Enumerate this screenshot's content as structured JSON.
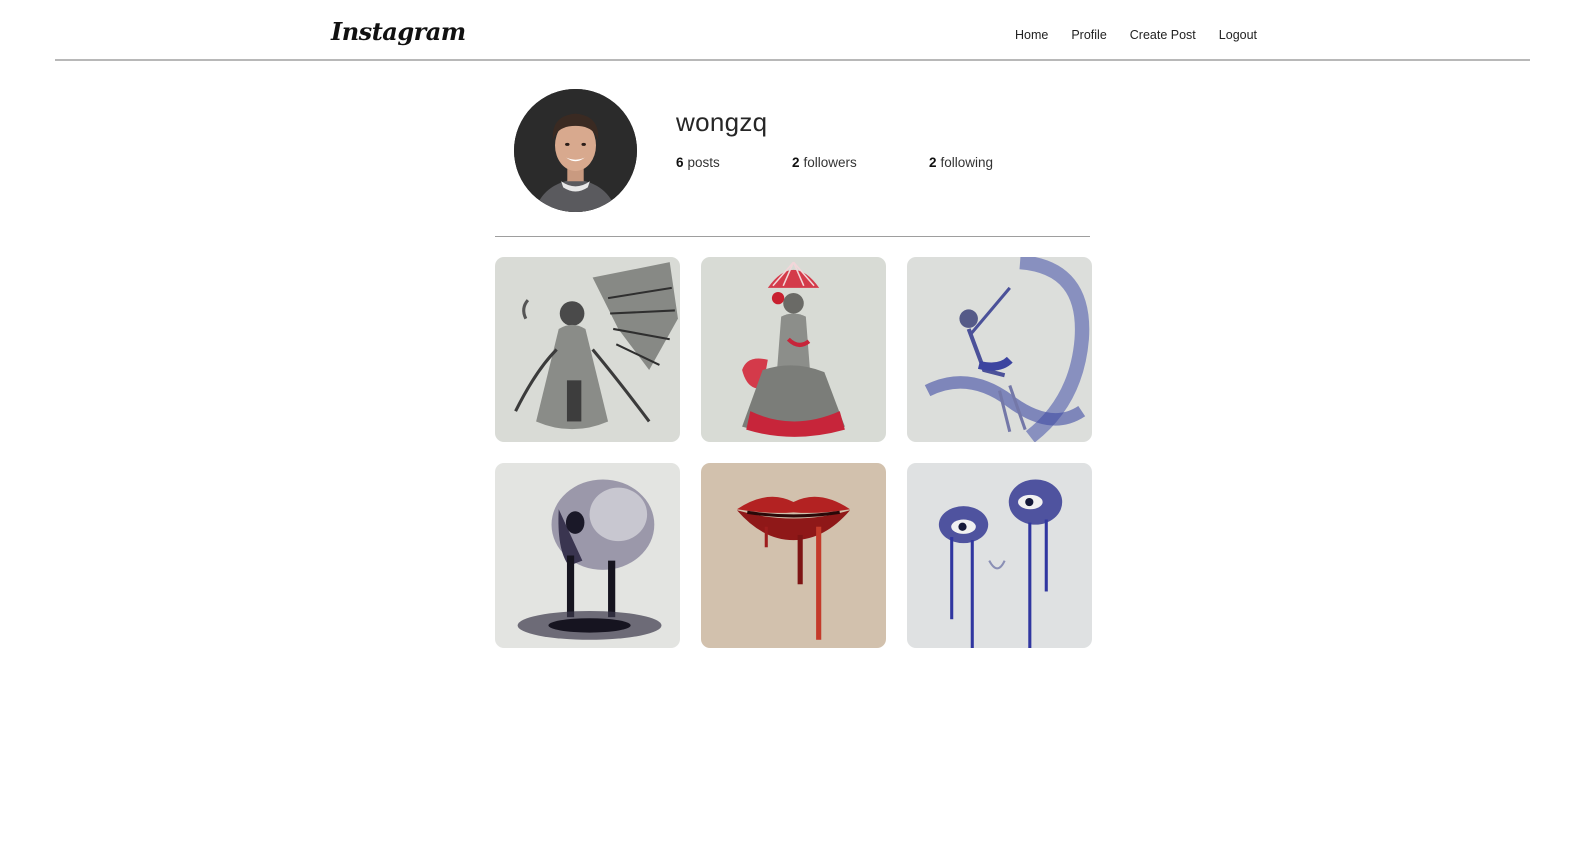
{
  "nav": {
    "brand": "Instagram",
    "links": [
      "Home",
      "Profile",
      "Create Post",
      "Logout"
    ]
  },
  "profile": {
    "username": "wongzq",
    "posts_count": "6",
    "posts_label": "posts",
    "followers_count": "2",
    "followers_label": "followers",
    "following_count": "2",
    "following_label": "following"
  },
  "colors": {
    "background": "#ffffff",
    "divider": "#9e9e9e",
    "text": "#262626"
  },
  "posts": [
    {
      "subject": "winged-geisha-pencil-drawing"
    },
    {
      "subject": "red-fan-dancer-drawing"
    },
    {
      "subject": "blue-ribbon-dancer-drawing"
    },
    {
      "subject": "dripping-skull-drawing"
    },
    {
      "subject": "dripping-red-lips-drawing"
    },
    {
      "subject": "blue-ink-eyes-drawing"
    }
  ]
}
